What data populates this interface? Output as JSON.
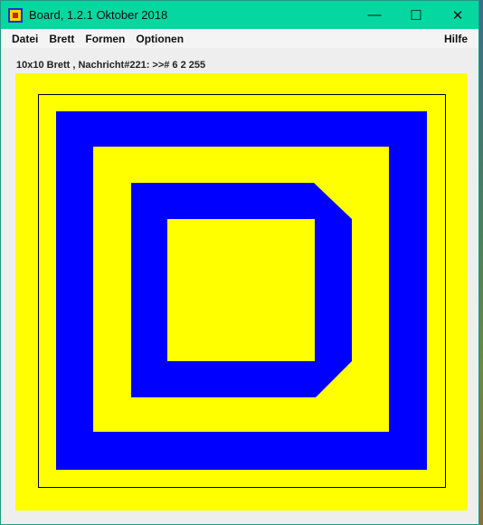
{
  "window": {
    "title": "Board, 1.2.1 Oktober 2018",
    "controls": {
      "minimize": "—",
      "maximize": "☐",
      "close": "✕"
    }
  },
  "menu": {
    "items": [
      "Datei",
      "Brett",
      "Formen",
      "Optionen"
    ],
    "help": "Hilfe"
  },
  "status": "10x10 Brett , Nachricht#221: >># 6 2 255",
  "board": {
    "size": "10x10",
    "colors": {
      "yellow": "#ffff00",
      "blue": "#0000ff",
      "frame": "#000000",
      "window_bg": "#eeeeee",
      "titlebar": "#06d7a0"
    }
  }
}
